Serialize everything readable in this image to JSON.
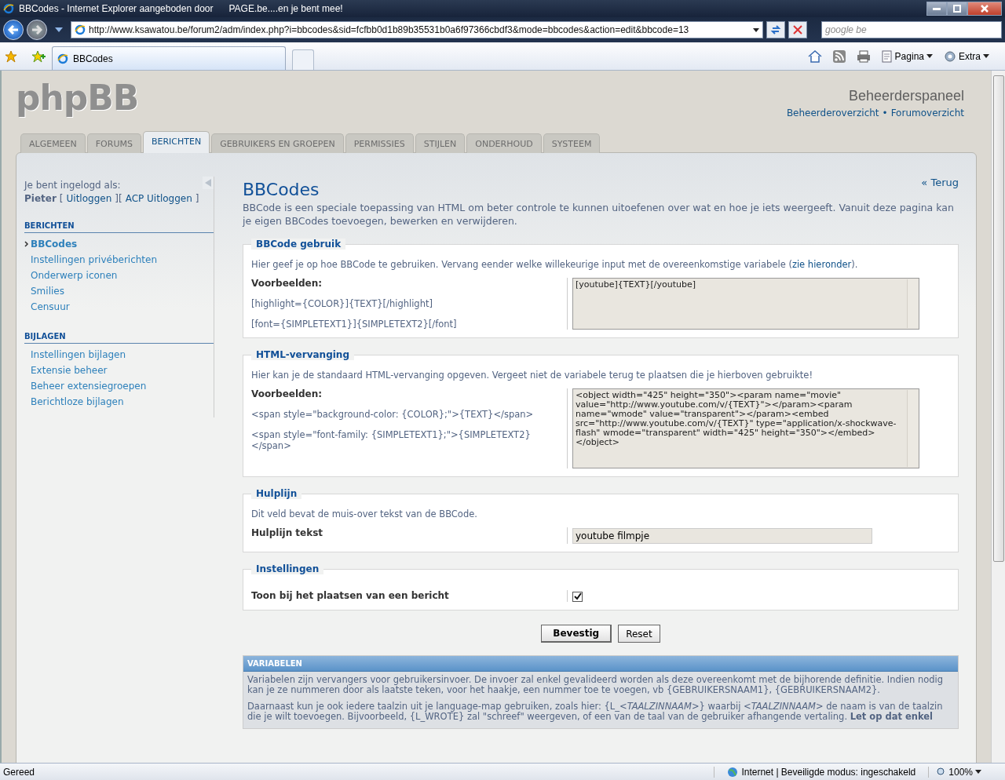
{
  "window": {
    "title": "BBCodes - Internet Explorer aangeboden door",
    "title_extra": "PAGE.be....en je bent mee!"
  },
  "browser": {
    "address": "http://www.ksawatou.be/forum2/adm/index.php?i=bbcodes&sid=fcfbb0d1b89b35531b0a6f97366cbdf3&mode=bbcodes&action=edit&bbcode=13",
    "search_placeholder": "google be",
    "tab": "BBCodes",
    "tools": [
      "Pagina",
      "Extra"
    ]
  },
  "header": {
    "logo": "phpBB",
    "title": "Beheerderspaneel",
    "links": [
      "Beheerderoverzicht",
      "Forumoverzicht"
    ],
    "separator": "•"
  },
  "tabs": [
    {
      "label": "ALGEMEEN",
      "selected": false
    },
    {
      "label": "FORUMS",
      "selected": false
    },
    {
      "label": "BERICHTEN",
      "selected": true
    },
    {
      "label": "GEBRUIKERS EN GROEPEN",
      "selected": false
    },
    {
      "label": "PERMISSIES",
      "selected": false
    },
    {
      "label": "STIJLEN",
      "selected": false
    },
    {
      "label": "ONDERHOUD",
      "selected": false
    },
    {
      "label": "SYSTEEM",
      "selected": false
    }
  ],
  "sidebar": {
    "login_label": "Je bent ingelogd als:",
    "user": "Pieter",
    "open": "[",
    "logout": "Uitloggen",
    "mid": "][",
    "acp_logout": "ACP Uitloggen",
    "close": "]",
    "sections": [
      {
        "title": "BERICHTEN",
        "items": [
          {
            "label": "BBCodes",
            "selected": true
          },
          {
            "label": "Instellingen privéberichten",
            "selected": false
          },
          {
            "label": "Onderwerp iconen",
            "selected": false
          },
          {
            "label": "Smilies",
            "selected": false
          },
          {
            "label": "Censuur",
            "selected": false
          }
        ]
      },
      {
        "title": "BIJLAGEN",
        "items": [
          {
            "label": "Instellingen bijlagen",
            "selected": false
          },
          {
            "label": "Extensie beheer",
            "selected": false
          },
          {
            "label": "Beheer extensiegroepen",
            "selected": false
          },
          {
            "label": "Berichtloze bijlagen",
            "selected": false
          }
        ]
      }
    ]
  },
  "main": {
    "back": "« Terug",
    "title": "BBCodes",
    "description": "BBCode is een speciale toepassing van HTML om beter controle te kunnen uitoefenen over wat en hoe je iets weergeeft. Vanuit deze pagina kan je eigen BBCodes toevoegen, bewerken en verwijderen.",
    "fieldsets": [
      {
        "legend": "BBCode gebruik",
        "intro": "Hier geef je op hoe BBCode te gebruiken. Vervang eender welke willekeurige input met de overeenkomstige variabele (",
        "intro_link": "zie hieronder",
        "intro_end": ").",
        "kind": "textarea",
        "label": "Voorbeelden:",
        "examples": [
          "[highlight={COLOR}]{TEXT}[/highlight]",
          "[font={SIMPLETEXT1}]{SIMPLETEXT2}[/font]"
        ],
        "value": "[youtube]{TEXT}[/youtube]"
      },
      {
        "legend": "HTML-vervanging",
        "intro": "Hier kan je de standaard HTML-vervanging opgeven. Vergeet niet de variabele terug te plaatsen die je hierboven gebruikte!",
        "kind": "textarea",
        "label": "Voorbeelden:",
        "examples": [
          "<span style=\"background-color: {COLOR};\">{TEXT}</span>",
          "<span style=\"font-family: {SIMPLETEXT1};\">{SIMPLETEXT2}</span>"
        ],
        "value": "<object width=\"425\" height=\"350\"><param name=\"movie\" value=\"http://www.youtube.com/v/{TEXT}\"></param><param name=\"wmode\" value=\"transparent\"></param><embed src=\"http://www.youtube.com/v/{TEXT}\" type=\"application/x-shockwave-flash\" wmode=\"transparent\" width=\"425\" height=\"350\"></embed></object>"
      },
      {
        "legend": "Hulplijn",
        "intro": "Dit veld bevat de muis-over tekst van de BBCode.",
        "kind": "input",
        "label": "Hulplijn tekst",
        "value": "youtube filmpje"
      },
      {
        "legend": "Instellingen",
        "kind": "checkbox",
        "label": "Toon bij het plaatsen van een bericht",
        "checked": true
      }
    ],
    "buttons": [
      "Bevestig",
      "Reset"
    ],
    "variables": {
      "title": "VARIABELEN",
      "paragraphs": [
        "Variabelen zijn vervangers voor gebruikersinvoer. De invoer zal enkel gevalideerd worden als deze overeenkomt met de bijhorende definitie. Indien nodig kan je ze nummeren door als laatste teken, voor het haakje, een nummer toe te voegen, vb {GEBRUIKERSNAAM1}, {GEBRUIKERSNAAM2}.",
        [
          "Daarnaast kun je ook iedere taalzin uit je language-map gebruiken, zoals hier: {L_",
          "*<TAALZINNAAM>*} waarbij *<TAALZINNAAM>* de naam is van de taalzin die je wilt toevoegen. Bijvoorbeeld, {L_WROTE} zal \"schreef\" weergeven, of een van de taal van de gebruiker afhangende vertaling. **Let op dat enkel**"
        ]
      ]
    }
  },
  "status": {
    "text": "Gereed",
    "zone": "Internet | Beveiligde modus: ingeschakeld",
    "zoom": "100%"
  }
}
